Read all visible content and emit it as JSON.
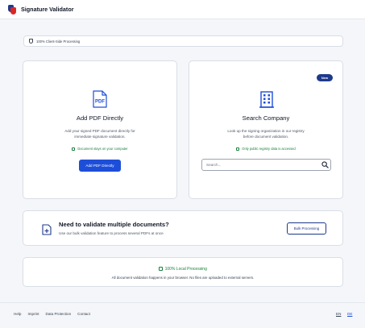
{
  "header": {
    "title": "Signature Validator"
  },
  "banner": {
    "text": "100% Client-Side Processing",
    "icon": "shield-icon"
  },
  "pdf_card": {
    "icon": "pdf-document-icon",
    "title": "Add PDF Directly",
    "description_line1": "Add your signed PDF document directly for",
    "description_line2": "immediate signature validation.",
    "note": "Document stays on your computer",
    "button": "Add PDF Directly"
  },
  "search_card": {
    "badge": "New",
    "icon": "company-building-icon",
    "title": "Search Company",
    "description_line1": "Look up the signing organization in our registry",
    "description_line2": "before document validation.",
    "note": "Only public registry data is accessed",
    "placeholder": "Search..."
  },
  "bulk": {
    "icon": "add-document-icon",
    "title": "Need to validate multiple documents?",
    "description": "Use our bulk validation feature to process several PDFs at once",
    "button": "Bulk Processing"
  },
  "local": {
    "title": "100% Local Processing",
    "description": "All document validation happens in your browser. No files are uploaded to external servers."
  },
  "footer": {
    "links": [
      "Help",
      "Imprint",
      "Data Protection",
      "Contact"
    ],
    "lang_en": "EN",
    "lang_de": "DE"
  },
  "colors": {
    "primary": "#1d4ed8",
    "navy": "#1e3a8a",
    "success": "#16803c",
    "logo_red": "#dc2626"
  }
}
